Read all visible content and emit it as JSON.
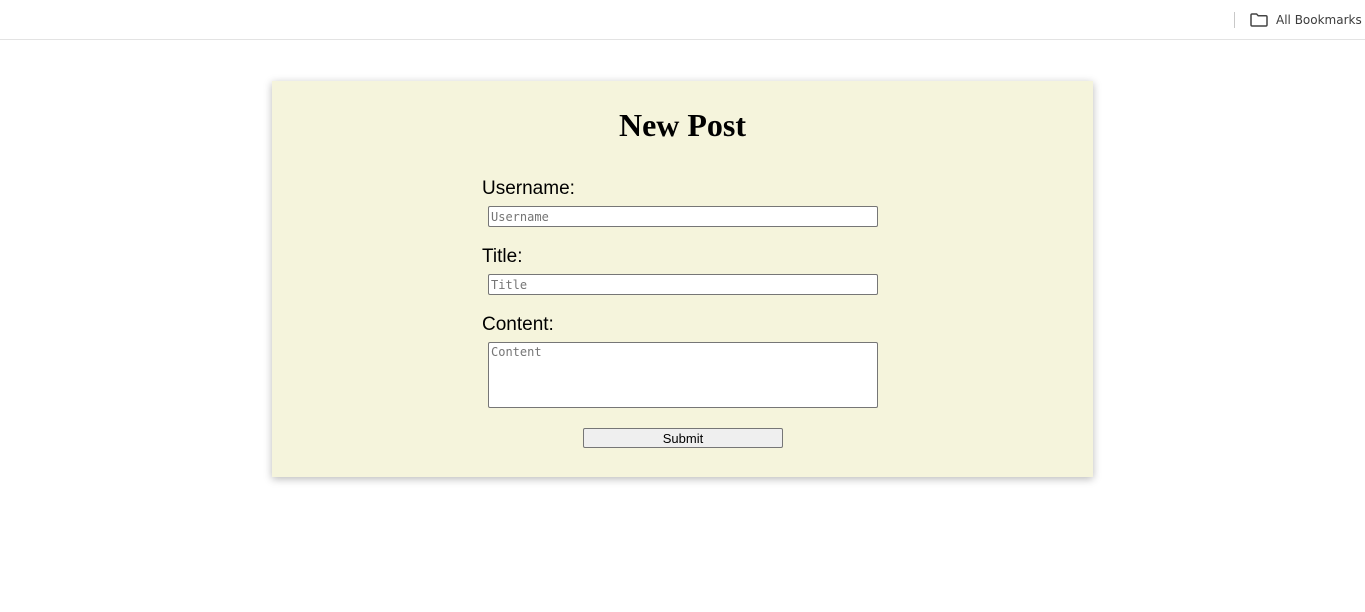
{
  "bookmarks_bar": {
    "all_bookmarks_label": "All Bookmarks",
    "icon": "folder-icon"
  },
  "form": {
    "title": "New Post",
    "username": {
      "label": "Username:",
      "placeholder": "Username",
      "value": ""
    },
    "post_title": {
      "label": "Title:",
      "placeholder": "Title",
      "value": ""
    },
    "content": {
      "label": "Content:",
      "placeholder": "Content",
      "value": ""
    },
    "submit_label": "Submit"
  },
  "colors": {
    "card_background": "#f5f4dc",
    "page_background": "#ffffff",
    "button_background": "#efefef"
  }
}
